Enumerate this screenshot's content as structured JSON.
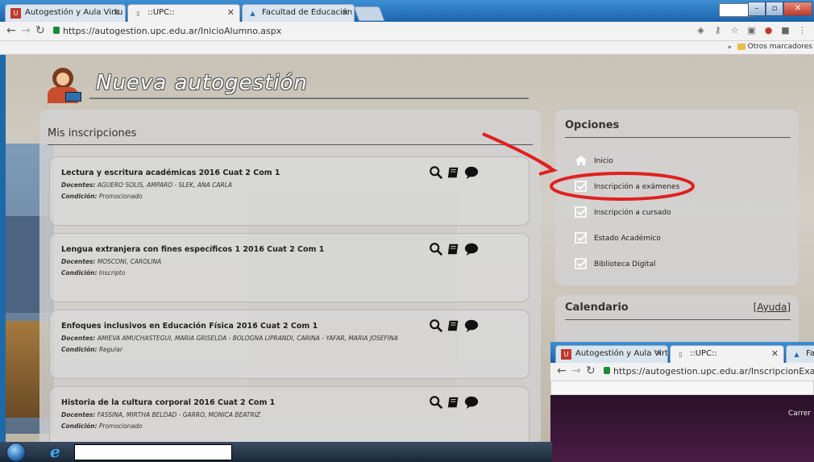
{
  "browser": {
    "tabs": [
      {
        "label": "Autogestión y Aula Virtu"
      },
      {
        "label": "::UPC::"
      },
      {
        "label": "Facultad de Educación y"
      }
    ],
    "url": "https://autogestion.upc.edu.ar/InicioAlumno.aspx",
    "bookmarks": {
      "more": "»",
      "folder": "Otros marcadores"
    }
  },
  "page": {
    "app_title": "Nueva autogestión",
    "inscriptions": {
      "title": "Mis inscripciones",
      "courses": [
        {
          "name": "Lectura y escritura académicas 2016 Cuat 2 Com 1",
          "docentes_label": "Docentes:",
          "docentes": "AGUERO SOLIS, AMPARO - SLEK, ANA CARLA",
          "condicion_label": "Condición:",
          "condicion": "Promocionado"
        },
        {
          "name": "Lengua extranjera con fines específicos 1 2016 Cuat 2 Com 1",
          "docentes_label": "Docentes:",
          "docentes": "MOSCONI, CAROLINA",
          "condicion_label": "Condición:",
          "condicion": "Inscripto"
        },
        {
          "name": "Enfoques inclusivos en Educación Física 2016 Cuat 2 Com 1",
          "docentes_label": "Docentes:",
          "docentes": "AMIEVA AMUCHASTEGUI, MARIA GRISELDA - BOLOGNA LIPRANDI, CARINA - YAFAR, MARIA JOSEFINA",
          "condicion_label": "Condición:",
          "condicion": "Regular"
        },
        {
          "name": "Historia de la cultura corporal 2016 Cuat 2 Com 1",
          "docentes_label": "Docentes:",
          "docentes": "FASSINA, MIRTHA BELDAD - GARRO, MONICA BEATRIZ",
          "condicion_label": "Condición:",
          "condicion": "Promocionado"
        }
      ]
    },
    "options": {
      "title": "Opciones",
      "items": [
        {
          "label": "Inicio",
          "icon": "home-icon"
        },
        {
          "label": "Inscripción a exámenes",
          "icon": "checkbox-icon"
        },
        {
          "label": "Inscripción a cursado",
          "icon": "checkbox-icon"
        },
        {
          "label": "Estado Académico",
          "icon": "checkbox-icon"
        },
        {
          "label": "Biblioteca Digital",
          "icon": "checkbox-icon"
        }
      ]
    },
    "calendar": {
      "title": "Calendario",
      "help": "[Ayuda]"
    }
  },
  "overlay_window": {
    "tabs": [
      {
        "label": "Autogestión y Aula Virtu"
      },
      {
        "label": "::UPC::"
      },
      {
        "label": "Fac"
      }
    ],
    "url": "https://autogestion.upc.edu.ar/InscripcionExamen.asp",
    "page_text": "Carrer"
  },
  "colors": {
    "annotation": "#e02020",
    "accent": "#1b63ab"
  }
}
